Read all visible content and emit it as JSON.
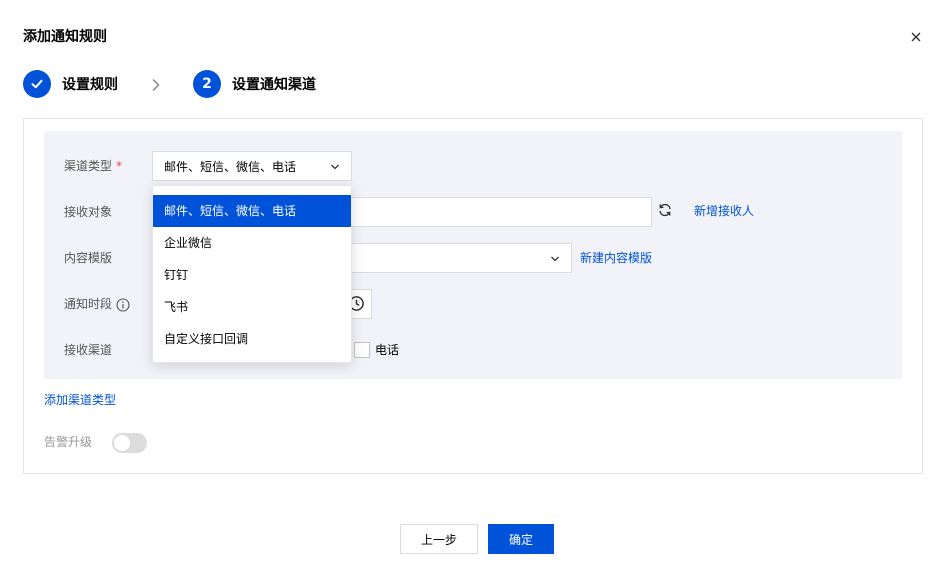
{
  "dialog": {
    "title": "添加通知规则"
  },
  "steps": [
    {
      "index": "1",
      "label": "设置规则",
      "status": "done"
    },
    {
      "index": "2",
      "label": "设置通知渠道",
      "status": "active"
    }
  ],
  "form": {
    "channel_type_label": "渠道类型",
    "required_mark": "*",
    "channel_type_value": "邮件、短信、微信、电话",
    "recipients_label": "接收对象",
    "add_recipient_link": "新增接收人",
    "template_label": "内容模版",
    "new_template_link": "新建内容模版",
    "time_label": "通知时段",
    "receive_channel_label": "接收渠道",
    "phone_checkbox_label": "电话"
  },
  "dropdown": {
    "options": [
      "邮件、短信、微信、电话",
      "企业微信",
      "钉钉",
      "飞书",
      "自定义接口回调"
    ],
    "selected": "邮件、短信、微信、电话"
  },
  "add_channel_link": "添加渠道类型",
  "alarm_upgrade_label": "告警升级",
  "alarm_upgrade_enabled": false,
  "buttons": {
    "prev": "上一步",
    "confirm": "确定"
  },
  "colors": {
    "accent": "#0052d9",
    "required": "#e54545",
    "panel_bg": "#f2f3f8"
  }
}
